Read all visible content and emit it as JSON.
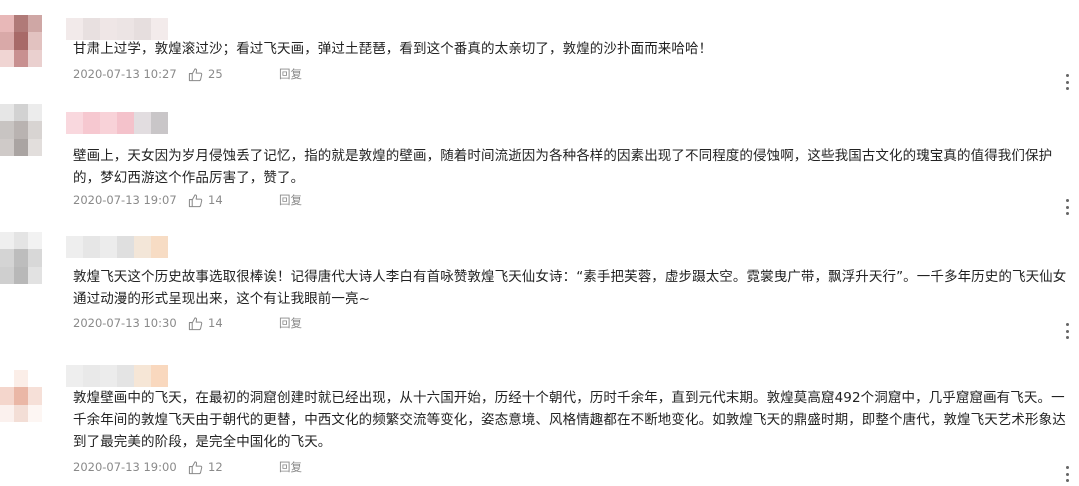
{
  "comments": [
    {
      "text": "甘肃上过学，敦煌滚过沙；看过飞天画，弹过土琵琶，看到这个番真的太亲切了，敦煌的沙扑面而来哈哈！",
      "date": "2020-07-13 10:27",
      "likes": "25",
      "reply_label": "回复",
      "avatar_colors": [
        "#e8b8b8",
        "#b07a78",
        "#cfa7a5",
        "#d9a9a8",
        "#a86a68",
        "#e2c2c0",
        "#f0d5d3",
        "#c89090",
        "#ead0cf"
      ],
      "name_colors": [
        "#f2eaea",
        "#e8e0e0",
        "#efe6e6",
        "#ece4e4",
        "#e6dede",
        "#f3ebeb"
      ]
    },
    {
      "text": "壁画上，天女因为岁月侵蚀丢了记忆，指的就是敦煌的壁画，随着时间流逝因为各种各样的因素出现了不同程度的侵蚀啊，这些我国古文化的瑰宝真的值得我们保护的，梦幻西游这个作品厉害了，赞了。",
      "date": "2020-07-13 19:07",
      "likes": "14",
      "reply_label": "回复",
      "avatar_colors": [
        "#e6e6e6",
        "#d2d2d2",
        "#ececec",
        "#c8c4c2",
        "#b9b3b1",
        "#d8d4d2",
        "#cfcac8",
        "#aaa4a2",
        "#e2dedc"
      ],
      "name_colors": [
        "#f9d8de",
        "#f6c8d0",
        "#f8d2d8",
        "#f4c2cb",
        "#e2dde0",
        "#c9c6c8"
      ]
    },
    {
      "text": "敦煌飞天这个历史故事选取很棒诶！记得唐代大诗人李白有首咏赞敦煌飞天仙女诗：“素手把芙蓉，虚步蹑太空。霓裳曳广带，飘浮升天行”。一千多年历史的飞天仙女通过动漫的形式呈现出来，这个有让我眼前一亮~",
      "date": "2020-07-13 10:30",
      "likes": "14",
      "reply_label": "回复",
      "avatar_colors": [
        "#efefef",
        "#e4e4e4",
        "#f2f2f2",
        "#d4d4d4",
        "#bdbdbd",
        "#d8d8d8",
        "#cfcfcf",
        "#b8b8b8",
        "#e2e2e2"
      ],
      "name_colors": [
        "#eeeeee",
        "#e6e6e6",
        "#ececec",
        "#dfdfdf",
        "#f3e6d8",
        "#f7dcc4"
      ]
    },
    {
      "text": "敦煌壁画中的飞天，在最初的洞窟创建时就已经出现，从十六国开始，历经十个朝代，历时千余年，直到元代末期。敦煌莫高窟492个洞窟中，几乎窟窟画有飞天。一千余年间的敦煌飞天由于朝代的更替，中西文化的频繁交流等变化，姿态意境、风格情趣都在不断地变化。如敦煌飞天的鼎盛时期，即整个唐代，敦煌飞天艺术形象达到了最完美的阶段，是完全中国化的飞天。",
      "date": "2020-07-13 19:00",
      "likes": "12",
      "reply_label": "回复",
      "avatar_colors": [
        "#ffffff",
        "#fbeee8",
        "#ffffff",
        "#f4d6cc",
        "#eab7a6",
        "#f6e0d8",
        "#fbf1ee",
        "#f3ded6",
        "#fdf6f3"
      ],
      "name_colors": [
        "#eeeeee",
        "#e9e9e9",
        "#ececec",
        "#e4e4e4",
        "#f6e6d6",
        "#f9d8be"
      ]
    }
  ]
}
